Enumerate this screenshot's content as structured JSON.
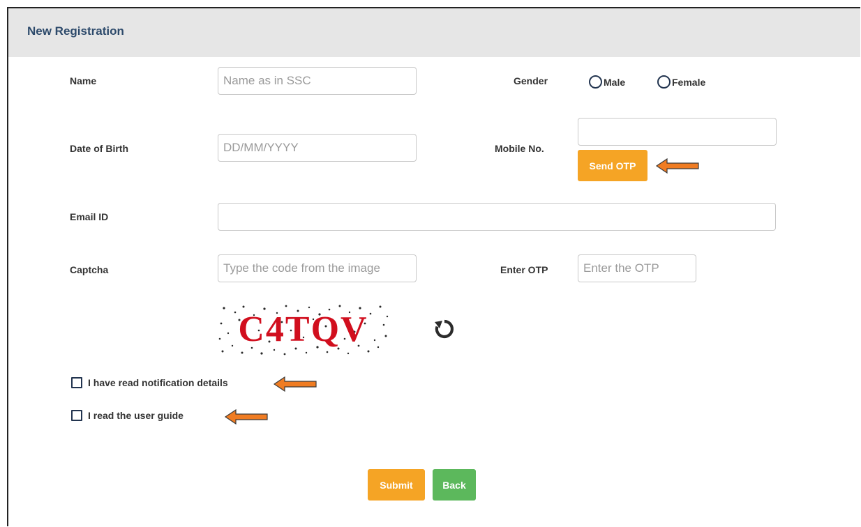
{
  "form": {
    "title": "New Registration",
    "name": {
      "label": "Name",
      "placeholder": "Name as in SSC",
      "value": ""
    },
    "gender": {
      "label": "Gender",
      "options": [
        "Male",
        "Female"
      ],
      "selected": null
    },
    "dob": {
      "label": "Date of Birth",
      "placeholder": "DD/MM/YYYY",
      "value": ""
    },
    "mobile": {
      "label": "Mobile No.",
      "placeholder": "",
      "value": ""
    },
    "send_otp": {
      "label": "Send OTP"
    },
    "email": {
      "label": "Email ID",
      "placeholder": "",
      "value": ""
    },
    "captcha": {
      "label": "Captcha",
      "placeholder": "Type the code from the image",
      "value": "",
      "image_text": "C4TQV",
      "refresh_icon": "refresh-icon"
    },
    "otp": {
      "label": "Enter OTP",
      "placeholder": "Enter the OTP",
      "value": ""
    },
    "checkboxes": [
      {
        "label": "I have read notification details",
        "checked": false
      },
      {
        "label": "I read the user guide",
        "checked": false
      }
    ],
    "submit": {
      "label": "Submit"
    },
    "back": {
      "label": "Back"
    }
  },
  "colors": {
    "accent_orange": "#f5a425",
    "accent_green": "#5cb85c",
    "title_color": "#2d4a6b",
    "annotation_arrow": "#f07c22"
  },
  "annotations": {
    "arrow_icon": "left-arrow-icon",
    "count": 3
  }
}
